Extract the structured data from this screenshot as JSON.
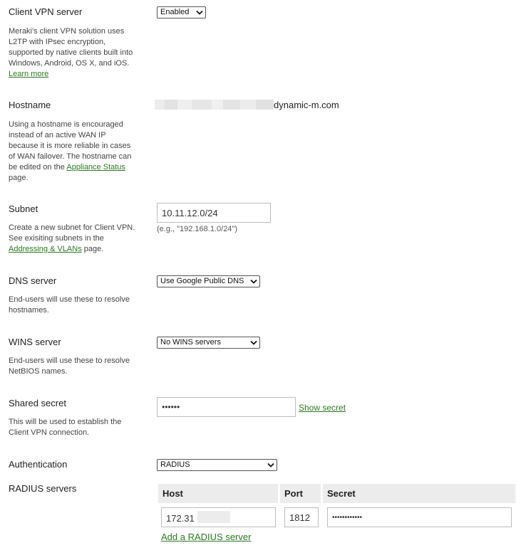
{
  "client_vpn": {
    "label": "Client VPN server",
    "value": "Enabled",
    "description": "Meraki's client VPN solution uses L2TP with IPsec encryption, supported by native clients built into Windows, Android, OS X, and iOS.",
    "learn_more": "Learn more"
  },
  "hostname": {
    "label": "Hostname",
    "value_suffix": "dynamic-m.com",
    "description_before": "Using a hostname is encouraged instead of an active WAN IP because it is more reliable in cases of WAN failover. The hostname can be edited on the",
    "link": "Appliance Status",
    "description_after": "page."
  },
  "subnet": {
    "label": "Subnet",
    "value": "10.11.12.0/24",
    "hint": "(e.g., \"192.168.1.0/24\")",
    "description_before": "Create a new subnet for Client VPN. See exisiting subnets in the",
    "link": "Addressing & VLANs",
    "description_after": "page."
  },
  "dns": {
    "label": "DNS server",
    "value": "Use Google Public DNS",
    "description": "End-users will use these to resolve hostnames."
  },
  "wins": {
    "label": "WINS server",
    "value": "No WINS servers",
    "description": "End-users will use these to resolve NetBIOS names."
  },
  "shared_secret": {
    "label": "Shared secret",
    "value": "••••••",
    "show_link": "Show secret",
    "description": "This will be used to establish the Client VPN connection."
  },
  "authentication": {
    "label": "Authentication",
    "value": "RADIUS"
  },
  "radius": {
    "label": "RADIUS servers",
    "columns": [
      "Host",
      "Port",
      "Secret"
    ],
    "rows": [
      {
        "host": "172.31",
        "port": "1812",
        "secret": "••••••••••••"
      }
    ],
    "add_link": "Add a RADIUS server"
  },
  "icons": {
    "select_caret": "chevron-down-icon"
  }
}
